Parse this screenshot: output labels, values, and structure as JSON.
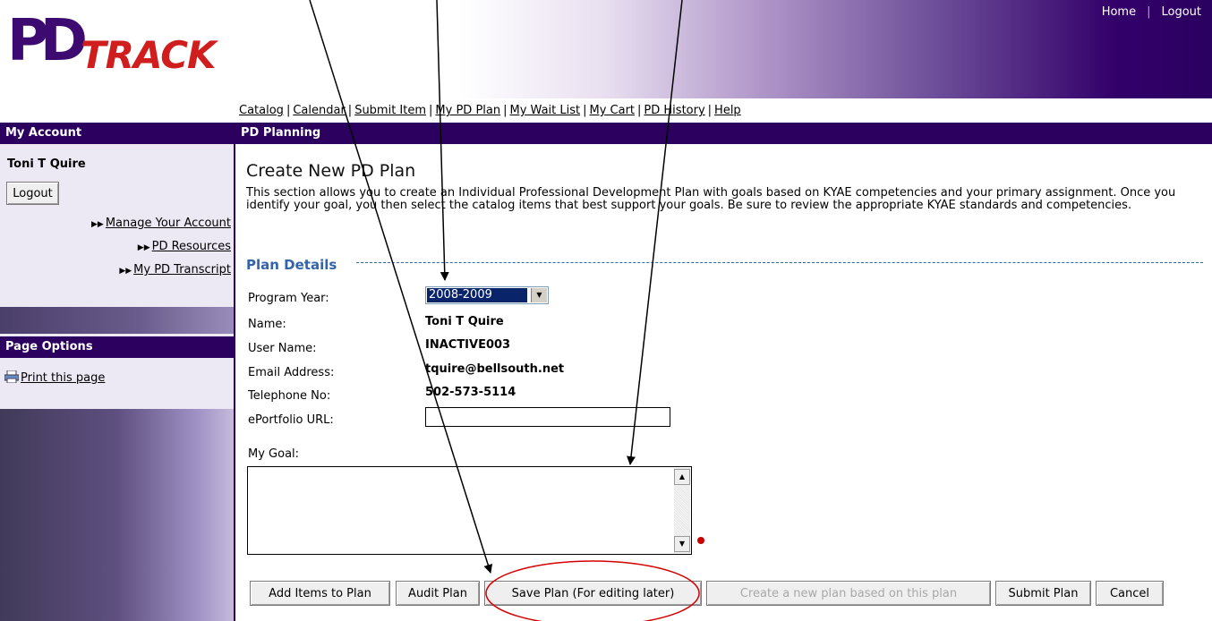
{
  "header": {
    "logo_pd": "PD",
    "logo_track": "TRACK",
    "links": [
      "Home",
      "Logout"
    ]
  },
  "nav": [
    "Catalog",
    "Calendar",
    "Submit Item",
    "My PD Plan",
    "My Wait List",
    "My Cart",
    "PD History",
    "Help"
  ],
  "sidebar": {
    "account_title": "My Account",
    "user_name": "Toni T Quire",
    "logout_label": "Logout",
    "links": [
      "Manage Your Account",
      "PD Resources",
      "My PD Transcript"
    ],
    "page_options_title": "Page Options",
    "print_label": "Print this page"
  },
  "main": {
    "section_title": "PD Planning",
    "page_title": "Create New PD Plan",
    "description": "This section allows you to create an Individual Professional Development Plan with goals based on KYAE competencies and your primary assignment. Once you identify your goal, you then select the catalog items that best support your goals. Be sure to review the appropriate KYAE standards and competencies.",
    "plan_details_heading": "Plan Details",
    "fields": {
      "program_year_label": "Program Year:",
      "program_year_value": "2008-2009",
      "name_label": "Name:",
      "name_value": "Toni T Quire",
      "username_label": "User Name:",
      "username_value": "INACTIVE003",
      "email_label": "Email Address:",
      "email_value": "tquire@bellsouth.net",
      "phone_label": "Telephone No:",
      "phone_value": "502-573-5114",
      "eportfolio_label": "ePortfolio URL:",
      "eportfolio_value": "",
      "goal_label": "My Goal:",
      "goal_value": ""
    },
    "buttons": {
      "add_items": "Add Items to Plan",
      "audit": "Audit Plan",
      "save": "Save Plan (For editing later)",
      "create_new": "Create a new plan based on this plan",
      "submit": "Submit Plan",
      "cancel": "Cancel"
    }
  },
  "colors": {
    "brand_purple": "#2b005e",
    "logo_red": "#d01e1e",
    "section_blue": "#3363a8",
    "annotation_red": "#d40000"
  }
}
